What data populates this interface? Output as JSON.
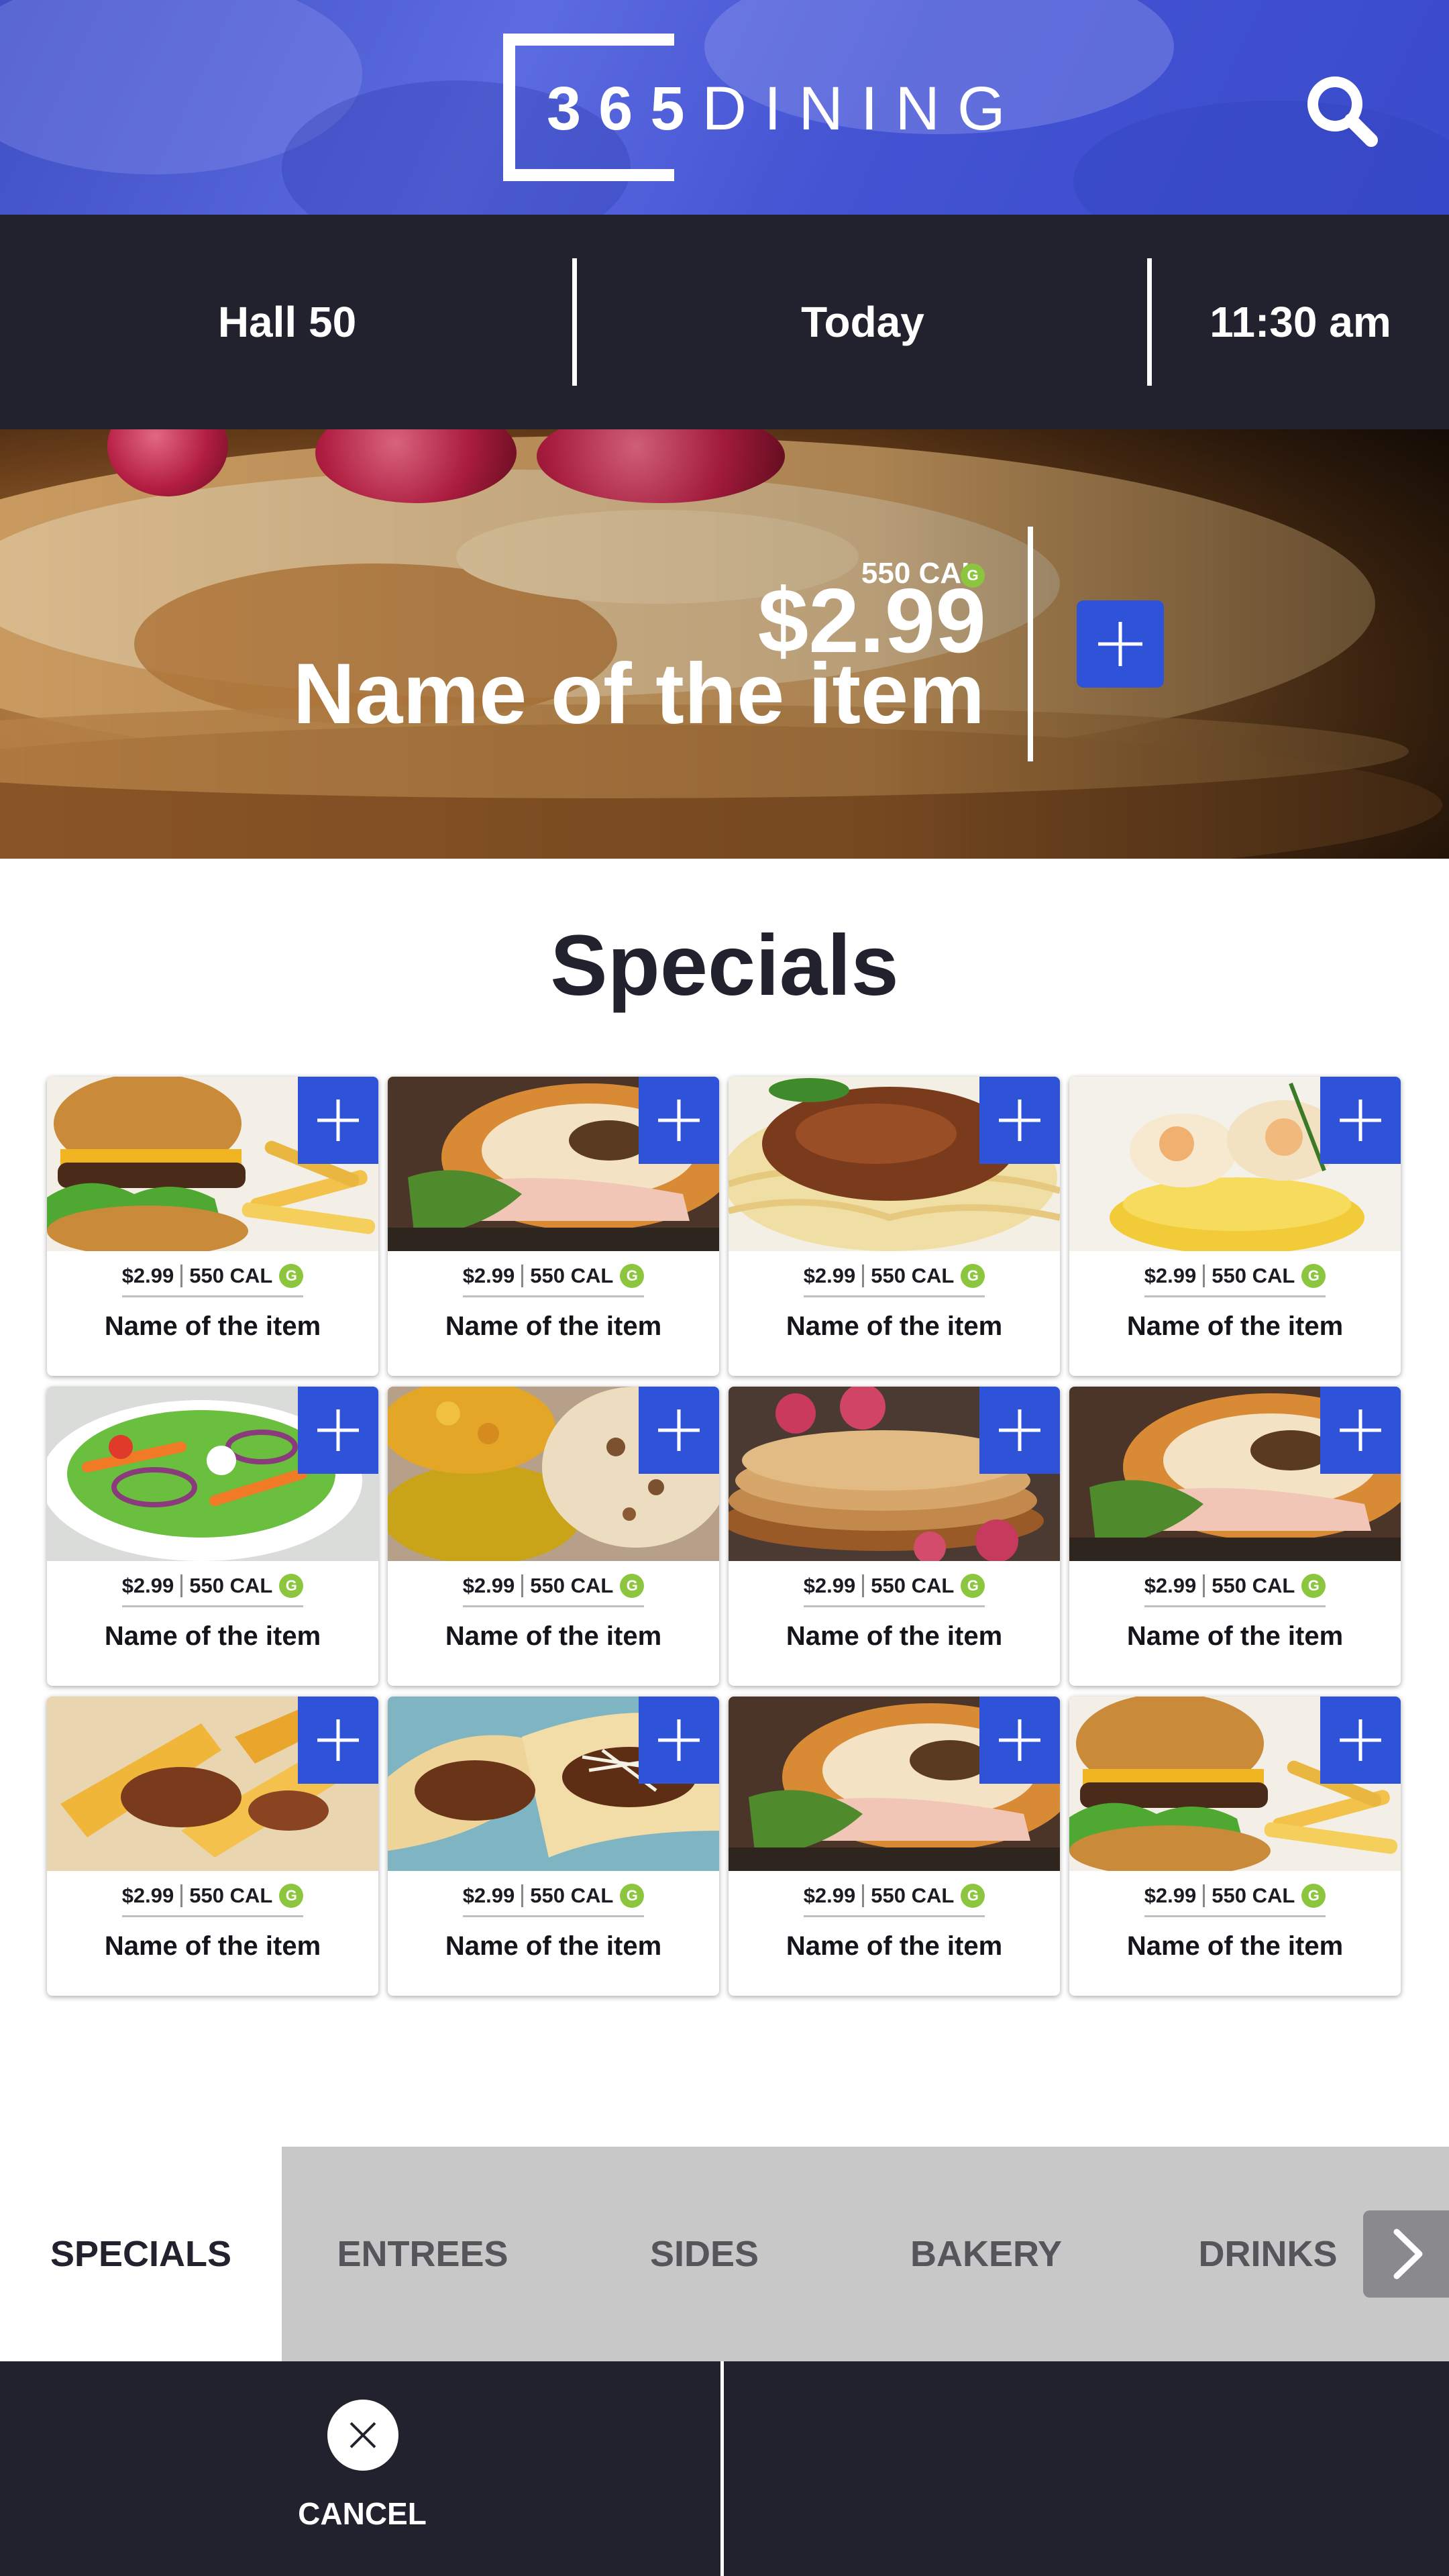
{
  "brand": {
    "logo_number": "365",
    "logo_word": "DINING"
  },
  "header": {
    "search_icon": "search-icon"
  },
  "info_bar": {
    "location": "Hall 50",
    "date": "Today",
    "time": "11:30 am"
  },
  "hero": {
    "calories": "550 CAL",
    "badge": "G",
    "price": "$2.99",
    "name": "Name of the item",
    "add_icon": "plus-icon"
  },
  "section": {
    "title": "Specials"
  },
  "cards": [
    {
      "price": "$2.99",
      "cal": "550 CAL",
      "badge": "G",
      "name": "Name of the item",
      "image": "burger-fries"
    },
    {
      "price": "$2.99",
      "cal": "550 CAL",
      "badge": "G",
      "name": "Name of the item",
      "image": "croissant-sandwich"
    },
    {
      "price": "$2.99",
      "cal": "550 CAL",
      "badge": "G",
      "name": "Name of the item",
      "image": "spaghetti-bolognese"
    },
    {
      "price": "$2.99",
      "cal": "550 CAL",
      "badge": "G",
      "name": "Name of the item",
      "image": "shrimp-polenta"
    },
    {
      "price": "$2.99",
      "cal": "550 CAL",
      "badge": "G",
      "name": "Name of the item",
      "image": "garden-salad"
    },
    {
      "price": "$2.99",
      "cal": "550 CAL",
      "badge": "G",
      "name": "Name of the item",
      "image": "curry-naan"
    },
    {
      "price": "$2.99",
      "cal": "550 CAL",
      "badge": "G",
      "name": "Name of the item",
      "image": "pancakes-raspberries"
    },
    {
      "price": "$2.99",
      "cal": "550 CAL",
      "badge": "G",
      "name": "Name of the item",
      "image": "croissant-sandwich"
    },
    {
      "price": "$2.99",
      "cal": "550 CAL",
      "badge": "G",
      "name": "Name of the item",
      "image": "baked-pasta"
    },
    {
      "price": "$2.99",
      "cal": "550 CAL",
      "badge": "G",
      "name": "Name of the item",
      "image": "tacos"
    },
    {
      "price": "$2.99",
      "cal": "550 CAL",
      "badge": "G",
      "name": "Name of the item",
      "image": "croissant-sandwich"
    },
    {
      "price": "$2.99",
      "cal": "550 CAL",
      "badge": "G",
      "name": "Name of the item",
      "image": "burger-fries"
    }
  ],
  "tabs": [
    {
      "label": "SPECIALS",
      "active": true
    },
    {
      "label": "ENTREES",
      "active": false
    },
    {
      "label": "SIDES",
      "active": false
    },
    {
      "label": "BAKERY",
      "active": false
    },
    {
      "label": "DRINKS",
      "active": false
    }
  ],
  "tabs_next_icon": "chevron-right-icon",
  "footer": {
    "cancel_label": "CANCEL",
    "cancel_icon": "close-icon"
  },
  "colors": {
    "header_blue": "#4353d2",
    "dark_bar": "#22212e",
    "accent_blue": "#2f53d8",
    "badge_green": "#8cc63f",
    "tab_gray": "#c8c8c8"
  }
}
